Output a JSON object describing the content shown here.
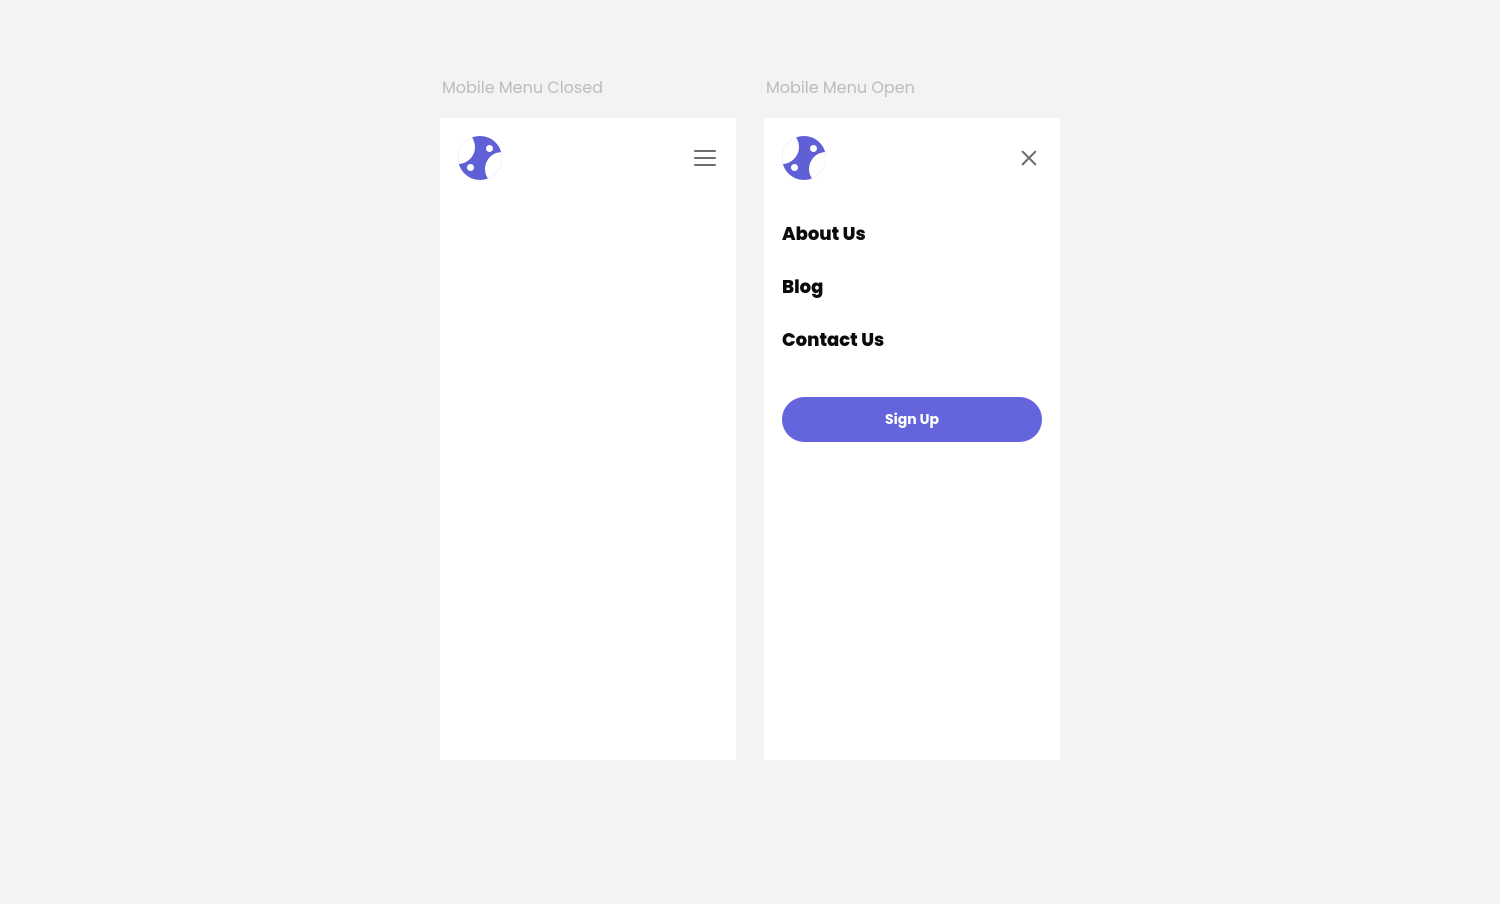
{
  "panels": {
    "closed_label": "Mobile Menu Closed",
    "open_label": "Mobile Menu Open"
  },
  "menu": {
    "items": [
      "About Us",
      "Blog",
      "Contact Us"
    ],
    "signup_label": "Sign Up"
  },
  "colors": {
    "brand": "#6464dc",
    "page_bg": "#f3f3f3"
  },
  "icons": {
    "hamburger": "hamburger-icon",
    "close": "close-icon",
    "logo": "logo-icon"
  }
}
